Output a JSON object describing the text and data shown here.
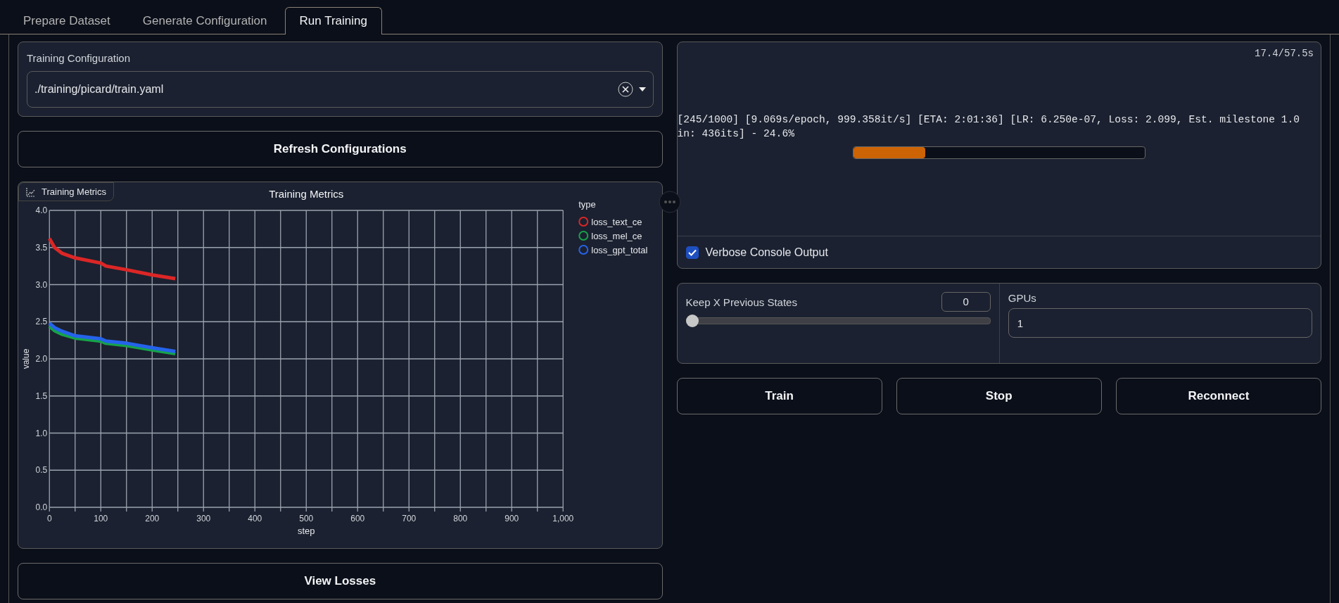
{
  "tabs": [
    {
      "label": "Prepare Dataset",
      "selected": false
    },
    {
      "label": "Generate Configuration",
      "selected": false
    },
    {
      "label": "Run Training",
      "selected": true
    }
  ],
  "training_configuration": {
    "label": "Training Configuration",
    "value": "./training/picard/train.yaml"
  },
  "refresh_button": "Refresh Configurations",
  "metrics": {
    "badge": "Training Metrics",
    "chart_data": {
      "type": "line",
      "grid": true,
      "legend": true,
      "title": "Training Metrics",
      "xlabel": "step",
      "ylabel": "value",
      "legend_title": "type",
      "x": [
        0,
        10,
        25,
        50,
        100,
        110,
        150,
        200,
        245
      ],
      "series": [
        {
          "name": "loss_text_ce",
          "color": "#dc2626",
          "values": [
            3.62,
            3.5,
            3.42,
            3.36,
            3.29,
            3.25,
            3.2,
            3.13,
            3.08
          ]
        },
        {
          "name": "loss_mel_ce",
          "color": "#16a34a",
          "values": [
            2.44,
            2.38,
            2.33,
            2.28,
            2.24,
            2.21,
            2.18,
            2.12,
            2.07
          ]
        },
        {
          "name": "loss_gpt_total",
          "color": "#2563eb",
          "values": [
            2.48,
            2.42,
            2.37,
            2.31,
            2.27,
            2.24,
            2.21,
            2.15,
            2.1
          ]
        }
      ],
      "xlim": [
        0,
        1000
      ],
      "ylim": [
        0,
        4
      ],
      "xticks": [
        0,
        100,
        200,
        300,
        400,
        500,
        600,
        700,
        800,
        900,
        {
          "value": 1000,
          "label": "1,000"
        }
      ],
      "yticks": [
        {
          "value": 0,
          "label": "0.0"
        },
        {
          "value": 0.5,
          "label": "0.5"
        },
        {
          "value": 1,
          "label": "1.0"
        },
        {
          "value": 1.5,
          "label": "1.5"
        },
        {
          "value": 2,
          "label": "2.0"
        },
        {
          "value": 2.5,
          "label": "2.5"
        },
        {
          "value": 3,
          "label": "3.0"
        },
        {
          "value": 3.5,
          "label": "3.5"
        },
        {
          "value": 4,
          "label": "4.0"
        }
      ]
    }
  },
  "view_losses_button": "View Losses",
  "console": {
    "timer": "17.4/57.5s",
    "message": "[245/1000] [9.069s/epoch, 999.358it/s] [ETA: 2:01:36] [LR: 6.250e-07, Loss: 2.099, Est. milestone 1.0 in: 436its] - 24.6%",
    "level": 0.246
  },
  "verbose": {
    "label": "Verbose Console Output",
    "checked": true
  },
  "keep_states": {
    "label": "Keep X Previous States",
    "value": "0",
    "level": 0
  },
  "gpus": {
    "label": "GPUs",
    "value": "1"
  },
  "buttons": [
    "Train",
    "Stop",
    "Reconnect"
  ]
}
